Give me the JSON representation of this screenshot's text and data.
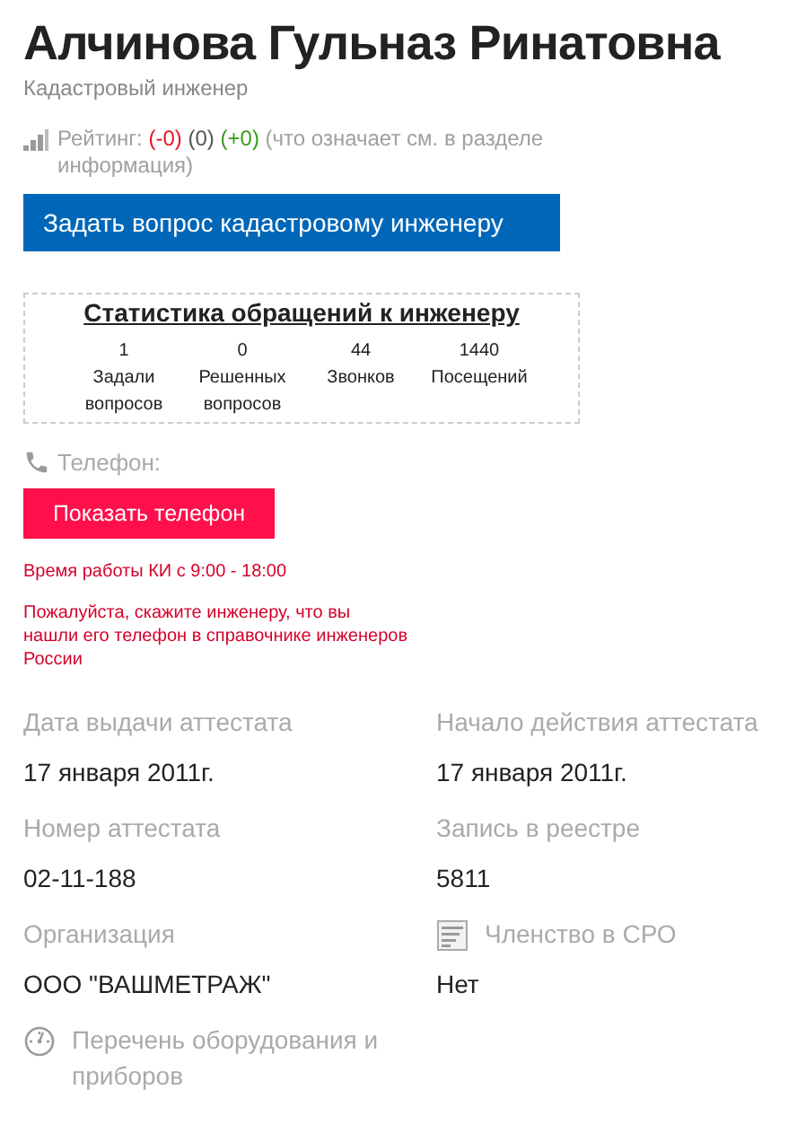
{
  "name": "Алчинова Гульназ Ринатовна",
  "role": "Кадастровый инженер",
  "rating": [
    {
      "text": "Рейтинг:",
      "color": "#a0a0a0"
    },
    {
      "text": "(-0)",
      "color": "#e8131c"
    },
    {
      "text": "(0)",
      "color": "#555555"
    },
    {
      "text": "(+0)",
      "color": "#3a9a1a"
    },
    {
      "text": "(что означает см. в разделе информация)",
      "color": "#a0a0a0"
    }
  ],
  "ask_button": "Задать вопрос кадастровому инженеру",
  "stats": {
    "title": "Статистика обращений к инженеру",
    "items": [
      {
        "value": "1",
        "label": "Задали вопросов"
      },
      {
        "value": "0",
        "label": "Решенных вопросов"
      },
      {
        "value": "44",
        "label": "Звонков"
      },
      {
        "value": "1440",
        "label": "Посещений"
      }
    ]
  },
  "phone_label": "Телефон:",
  "phone_button": "Показать телефон",
  "hours": "Время работы КИ с 9:00 - 18:00",
  "notice": "Пожалуйста, скажите инженеру, что вы нашли его телефон в справочнике инженеров России",
  "fields": [
    {
      "kind": "plain",
      "label": "Дата выдачи аттестата",
      "value": "17 января 2011г."
    },
    {
      "kind": "plain",
      "label": "Начало действия аттестата",
      "value": "17 января 2011г."
    },
    {
      "kind": "plain",
      "label": "Номер аттестата",
      "value": "02-11-188"
    },
    {
      "kind": "plain",
      "label": "Запись в реестре",
      "value": "5811"
    },
    {
      "kind": "plain",
      "label": "Организация",
      "value": "ООО \"ВАШМЕТРАЖ\""
    },
    {
      "kind": "document",
      "label": "Членство в СРО",
      "value": "Нет"
    },
    {
      "kind": "gauge",
      "label": "Перечень оборудования и приборов"
    }
  ]
}
